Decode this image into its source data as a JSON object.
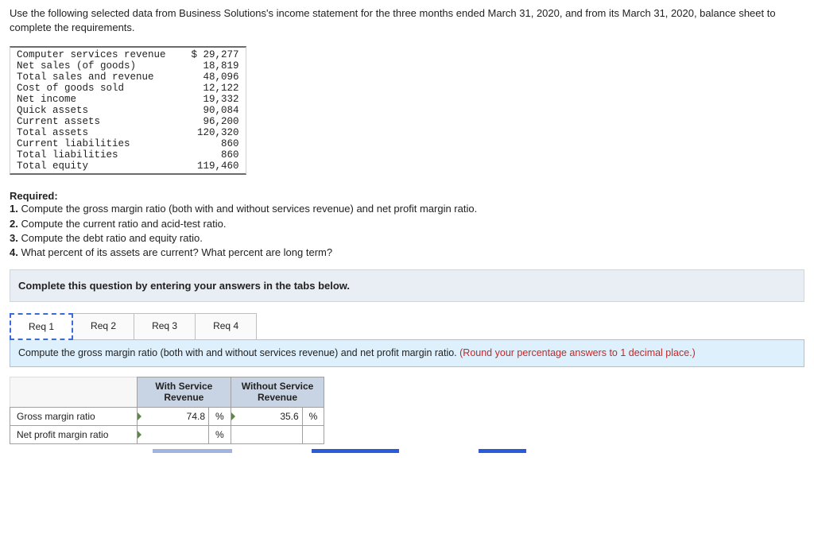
{
  "intro": "Use the following selected data from Business Solutions's income statement for the three months ended March 31, 2020, and from its March 31, 2020, balance sheet to complete the requirements.",
  "data_rows": [
    {
      "label": "Computer services revenue",
      "value": "$ 29,277"
    },
    {
      "label": "Net sales (of goods)",
      "value": "18,819"
    },
    {
      "label": "Total sales and revenue",
      "value": "48,096"
    },
    {
      "label": "Cost of goods sold",
      "value": "12,122"
    },
    {
      "label": "Net income",
      "value": "19,332"
    },
    {
      "label": "Quick assets",
      "value": "90,084"
    },
    {
      "label": "Current assets",
      "value": "96,200"
    },
    {
      "label": "Total assets",
      "value": "120,320"
    },
    {
      "label": "Current liabilities",
      "value": "860"
    },
    {
      "label": "Total liabilities",
      "value": "860"
    },
    {
      "label": "Total equity",
      "value": "119,460"
    }
  ],
  "required_title": "Required:",
  "required": [
    "1. Compute the gross margin ratio (both with and without services revenue) and net profit margin ratio.",
    "2. Compute the current ratio and acid-test ratio.",
    "3. Compute the debt ratio and equity ratio.",
    "4. What percent of its assets are current? What percent are long term?"
  ],
  "banner": "Complete this question by entering your answers in the tabs below.",
  "tabs": {
    "t1": "Req 1",
    "t2": "Req 2",
    "t3": "Req 3",
    "t4": "Req 4"
  },
  "tab_prompt_main": "Compute the gross margin ratio (both with and without services revenue) and net profit margin ratio. ",
  "tab_prompt_round": "(Round your percentage answers to 1 decimal place.)",
  "answer": {
    "col1": "With Service Revenue",
    "col2": "Without Service Revenue",
    "rows": [
      {
        "label": "Gross margin ratio",
        "v1": "74.8",
        "u1": "%",
        "v2": "35.6",
        "u2": "%"
      },
      {
        "label": "Net profit margin ratio",
        "v1": "",
        "u1": "%",
        "v2": "",
        "u2": ""
      }
    ]
  }
}
